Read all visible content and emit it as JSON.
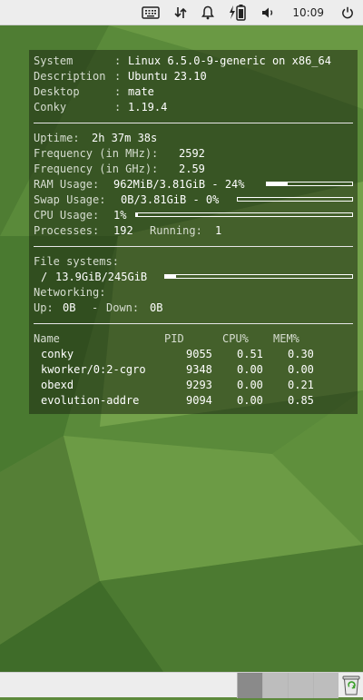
{
  "topbar": {
    "clock": "10:09",
    "icons": [
      "keyboard-icon",
      "network-icon",
      "notification-bell-icon",
      "battery-charging-icon",
      "volume-icon",
      "power-icon"
    ]
  },
  "conky": {
    "system": [
      {
        "label": "System",
        "value": "Linux 6.5.0-9-generic on x86_64"
      },
      {
        "label": "Description",
        "value": "Ubuntu 23.10"
      },
      {
        "label": "Desktop",
        "value": "mate"
      },
      {
        "label": "Conky",
        "value": "1.19.4"
      }
    ],
    "uptime": {
      "label": "Uptime:",
      "value": "2h 37m 38s"
    },
    "freq_mhz": {
      "label": "Frequency (in MHz):",
      "value": "2592"
    },
    "freq_ghz": {
      "label": "Frequency (in GHz):",
      "value": "2.59"
    },
    "ram": {
      "label": "RAM Usage:",
      "value": "962MiB/3.81GiB - 24%",
      "percent": 24
    },
    "swap": {
      "label": "Swap Usage:",
      "value": "0B/3.81GiB - 0%",
      "percent": 0
    },
    "cpu": {
      "label": "CPU Usage:",
      "value": "1%",
      "percent": 1
    },
    "processes": {
      "label": "Processes:",
      "value": "192",
      "running_label": "Running:",
      "running_value": "1"
    },
    "fs_title": "File systems:",
    "fs": {
      "mount": "/",
      "value": "13.9GiB/245GiB",
      "percent": 6
    },
    "net_title": "Networking:",
    "net": {
      "up_label": "Up:",
      "up_value": "0B",
      "sep": "-",
      "down_label": "Down:",
      "down_value": "0B"
    },
    "table": {
      "headers": [
        "Name",
        "PID",
        "CPU%",
        "MEM%"
      ],
      "rows": [
        [
          "conky",
          "9055",
          "0.51",
          "0.30"
        ],
        [
          "kworker/0:2-cgro",
          "9348",
          "0.00",
          "0.00"
        ],
        [
          "obexd",
          "9293",
          "0.00",
          "0.21"
        ],
        [
          "evolution-addre",
          "9094",
          "0.00",
          "0.85"
        ]
      ]
    }
  },
  "colors": {
    "desktop_green": "#5d8a3c",
    "panel_bg": "#ededed",
    "conky_text": "#d6ddd0"
  }
}
